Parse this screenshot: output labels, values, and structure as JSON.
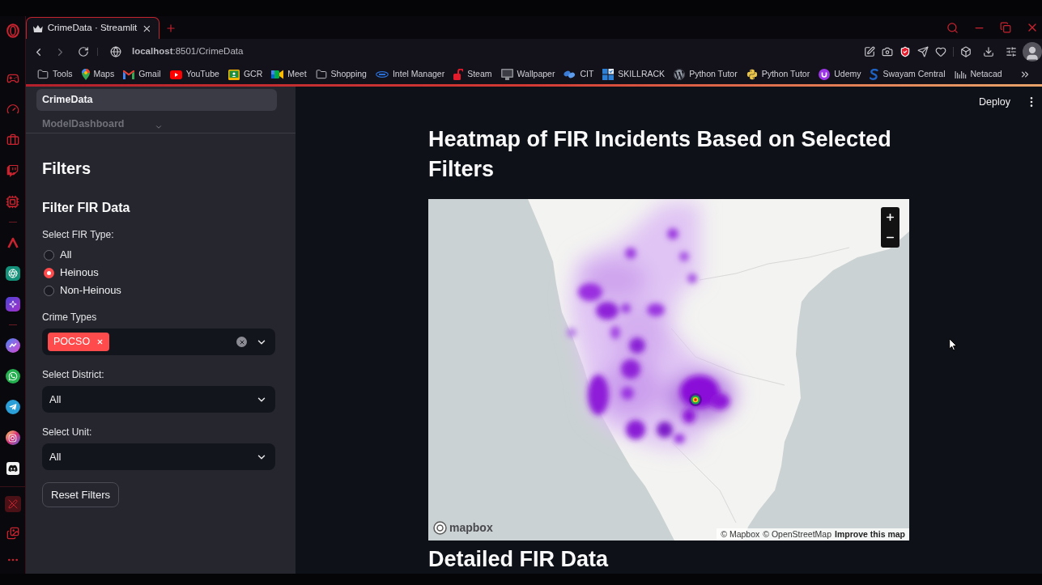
{
  "browser": {
    "tabs": [
      {
        "title": "CrimeData · Streamlit",
        "selected": true
      }
    ],
    "url": "**localhost**:8501/CrimeData",
    "bookmarks": [
      {
        "label": "Tools",
        "kind": "folder"
      },
      {
        "label": "Maps",
        "kind": "pin"
      },
      {
        "label": "Gmail",
        "kind": "mail"
      },
      {
        "label": "YouTube",
        "kind": "play"
      },
      {
        "label": "GCR",
        "kind": "board"
      },
      {
        "label": "Meet",
        "kind": "camera"
      },
      {
        "label": "Shopping",
        "kind": "folder"
      },
      {
        "label": "Intel Manager",
        "kind": "oval"
      },
      {
        "label": "Steam",
        "kind": "lock"
      },
      {
        "label": "Wallpaper",
        "kind": "monitor"
      },
      {
        "label": "CIT",
        "kind": "wings"
      },
      {
        "label": "SKILLRACK",
        "kind": "grid"
      },
      {
        "label": "Python Tutor",
        "kind": "wordpress"
      },
      {
        "label": "Python Tutor",
        "kind": "python"
      },
      {
        "label": "Udemy",
        "kind": "cup"
      },
      {
        "label": "Swayam Central",
        "kind": "swoosh"
      },
      {
        "label": "Netacad",
        "kind": "bars"
      }
    ]
  },
  "sidebar": {
    "nav": [
      {
        "label": "CrimeData",
        "selected": true
      },
      {
        "label": "ModelDashboard",
        "selected": false
      }
    ],
    "title": "Filters",
    "subtitle": "Filter FIR Data",
    "fir_type": {
      "label": "Select FIR Type:",
      "options": [
        {
          "label": "All",
          "selected": false
        },
        {
          "label": "Heinous",
          "selected": true
        },
        {
          "label": "Non-Heinous",
          "selected": false
        }
      ]
    },
    "crime_types": {
      "label": "Crime Types",
      "tags": [
        "POCSO"
      ]
    },
    "district": {
      "label": "Select District:",
      "value": "All"
    },
    "unit": {
      "label": "Select Unit:",
      "value": "All"
    },
    "reset_button": "Reset Filters"
  },
  "header": {
    "deploy_button": "Deploy"
  },
  "main": {
    "heading": "Heatmap of FIR Incidents Based on Selected Filters",
    "map": {
      "logo": "mapbox",
      "attribution": [
        {
          "label": "© Mapbox",
          "bold": false
        },
        {
          "label": "© OpenStreetMap",
          "bold": false
        },
        {
          "label": "Improve this map",
          "bold": true
        }
      ]
    },
    "next_heading": "Detailed FIR Data"
  }
}
